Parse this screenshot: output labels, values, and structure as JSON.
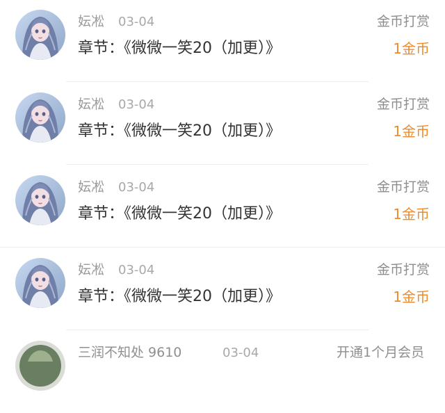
{
  "records": [
    {
      "username": "妘凇",
      "date": "03-04",
      "chapter": "章节：《微微一笑20（加更）》",
      "action": "金币打赏",
      "amount": "1金币"
    },
    {
      "username": "妘凇",
      "date": "03-04",
      "chapter": "章节：《微微一笑20（加更）》",
      "action": "金币打赏",
      "amount": "1金币"
    },
    {
      "username": "妘凇",
      "date": "03-04",
      "chapter": "章节：《微微一笑20（加更）》",
      "action": "金币打赏",
      "amount": "1金币"
    },
    {
      "username": "妘凇",
      "date": "03-04",
      "chapter": "章节：《微微一笑20（加更）》",
      "action": "金币打赏",
      "amount": "1金币"
    }
  ],
  "partial": {
    "username": "三润不知处 9610",
    "date": "03-04",
    "action": "开通1个月会员"
  },
  "colors": {
    "amount": "#ee8a2b",
    "secondary_text": "#9a9a9a",
    "primary_text": "#333333",
    "divider": "#eeeeee"
  },
  "icons": {
    "avatar": "anime-girl-avatar-icon",
    "partial_avatar": "green-avatar-icon"
  }
}
